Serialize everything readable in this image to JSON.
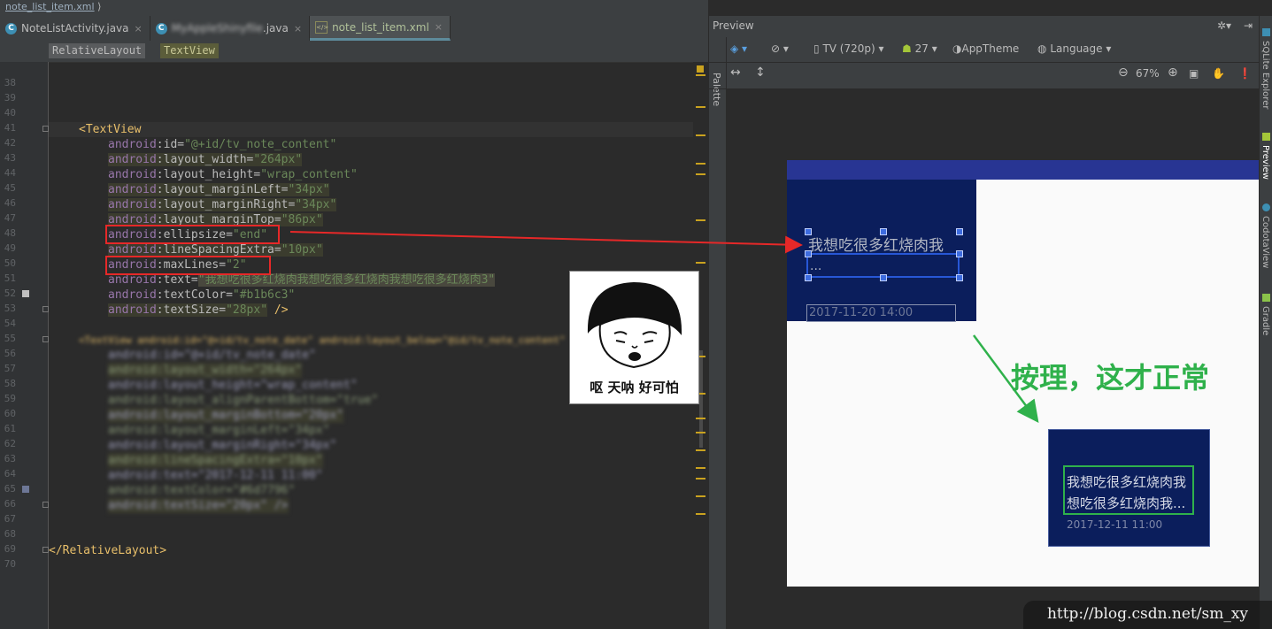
{
  "breadcrumb": "note_list_item.xml",
  "tabs": [
    {
      "label": "NoteListActivity.java",
      "icon": "java-class-icon",
      "active": false
    },
    {
      "label": "████████████.java",
      "icon": "java-class-icon",
      "active": false,
      "blurred_prefix": "MyAppleShinyfile"
    },
    {
      "label": "note_list_item.xml",
      "icon": "xml-file-icon",
      "active": true
    }
  ],
  "chips": [
    "RelativeLayout",
    "TextView"
  ],
  "lines": [
    "38",
    "39",
    "40",
    "41",
    "42",
    "43",
    "44",
    "45",
    "46",
    "47",
    "48",
    "49",
    "50",
    "51",
    "52",
    "53",
    "54",
    "55",
    "56",
    "57",
    "58",
    "59",
    "60",
    "61",
    "62",
    "63",
    "64",
    "65",
    "66",
    "67",
    "68",
    "69",
    "70"
  ],
  "code": {
    "open_tag": "<TextView",
    "id": [
      "android",
      ":id=",
      "\"@+id/tv_note_content\""
    ],
    "layout_width": [
      "android",
      ":layout_width=",
      "\"264px\""
    ],
    "layout_height": [
      "android",
      ":layout_height=",
      "\"wrap_content\""
    ],
    "marginLeft": [
      "android",
      ":layout_marginLeft=",
      "\"34px\""
    ],
    "marginRight": [
      "android",
      ":layout_marginRight=",
      "\"34px\""
    ],
    "marginTop": [
      "android",
      ":layout_marginTop=",
      "\"86px\""
    ],
    "ellipsize": [
      "android",
      ":ellipsize=",
      "\"end\""
    ],
    "lineSpacing": [
      "android",
      ":lineSpacingExtra=",
      "\"10px\""
    ],
    "maxLines": [
      "android",
      ":maxLines=",
      "\"2\""
    ],
    "text": [
      "android",
      ":text=",
      "\"我想吃很多红烧肉我想吃很多红烧肉我想吃很多红烧肉3\""
    ],
    "textColor": [
      "android",
      ":textColor=",
      "\"#b1b6c3\""
    ],
    "textSize": [
      "android",
      ":textSize=",
      "\"28px\"",
      " />"
    ],
    "blurred_open": "<TextView android:id=\"@+id/tv_note_date\" android:layout_below=\"@id/tv_note_content\"",
    "blurred_lines": [
      "android:id=\"@+id/tv_note_date\"",
      "android:layout_width=\"264px\"",
      "android:layout_height=\"wrap_content\"",
      "android:layout_alignParentBottom=\"true\"",
      "android:layout_marginBottom=\"20px\"",
      "android:layout_marginLeft=\"34px\"",
      "android:layout_marginRight=\"34px\"",
      "android:lineSpacingExtra=\"10px\"",
      "android:text=\"2017-12-11 11:00\"",
      "android:textColor=\"#6d7796\"",
      "android:textSize=\"20px\" />"
    ],
    "close_tag": "</RelativeLayout>"
  },
  "meme": {
    "caption": "呕 天呐 好可怕"
  },
  "preview": {
    "title": "Preview",
    "palette": "Palette",
    "device": "TV (720p)",
    "api": "27",
    "theme": "AppTheme",
    "language": "Language",
    "zoom": "67%",
    "card1_text": "我想吃很多红烧肉我",
    "card1_ellipsis": "...",
    "card1_date": "2017-11-20 14:00",
    "card2_line1": "我想吃很多红烧肉我",
    "card2_line2": "想吃很多红烧肉我...",
    "card2_date": "2017-12-11 11:00",
    "device_bar_color": "#283593",
    "card_color": "#0b1e5c"
  },
  "annotation": "按理，这才正常",
  "right_tabs": [
    "SQLite Explorer",
    "Preview",
    "CodotaView",
    "Gradle"
  ],
  "watermark": "http://blog.csdn.net/sm_xy"
}
